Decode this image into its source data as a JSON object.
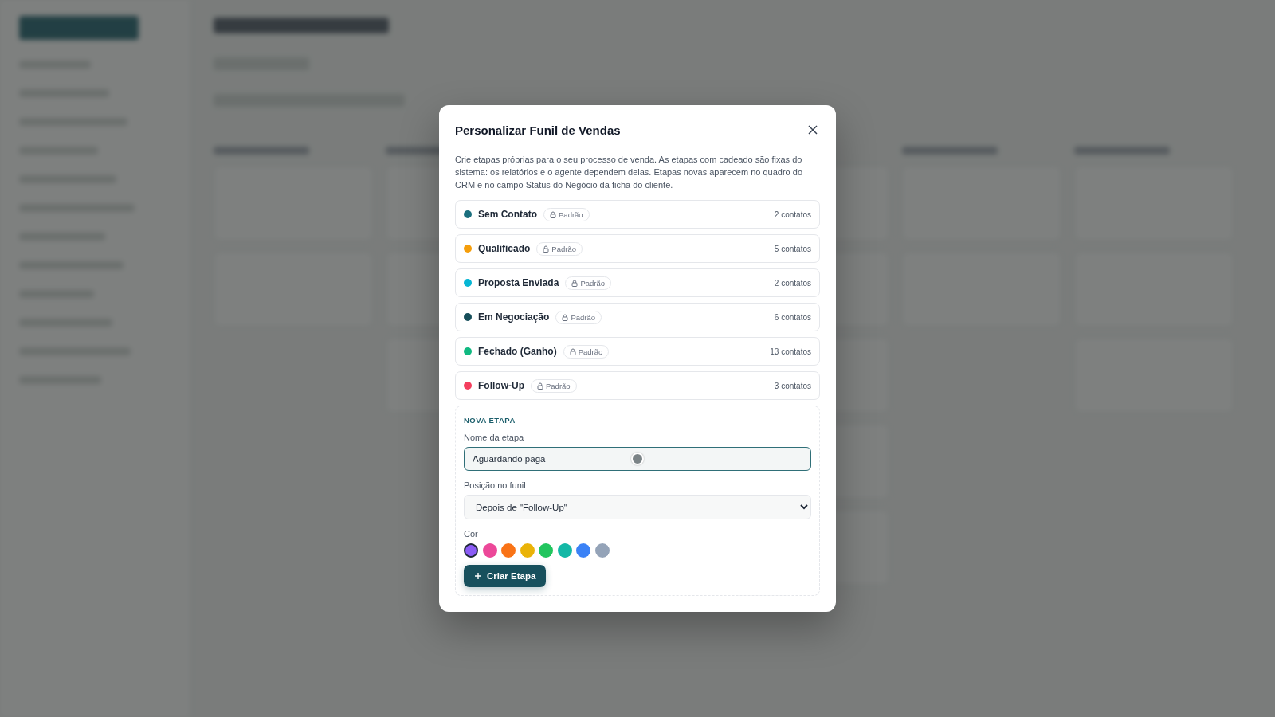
{
  "dialog": {
    "title": "Personalizar Funil de Vendas",
    "description": "Crie etapas próprias para o seu processo de venda. As etapas com cadeado são fixas do sistema: os relatórios e o agente dependem delas. Etapas novas aparecem no quadro do CRM e no campo Status do Negócio da ficha do cliente.",
    "stages": [
      {
        "name": "Sem Contato",
        "badge": "Padrão",
        "count": "2 contatos",
        "color": "#1b6f7e"
      },
      {
        "name": "Qualificado",
        "badge": "Padrão",
        "count": "5 contatos",
        "color": "#f59e0b"
      },
      {
        "name": "Proposta Enviada",
        "badge": "Padrão",
        "count": "2 contatos",
        "color": "#06b6d4"
      },
      {
        "name": "Em Negociação",
        "badge": "Padrão",
        "count": "6 contatos",
        "color": "#164e5a"
      },
      {
        "name": "Fechado (Ganho)",
        "badge": "Padrão",
        "count": "13 contatos",
        "color": "#10b981"
      },
      {
        "name": "Follow-Up",
        "badge": "Padrão",
        "count": "3 contatos",
        "color": "#f43f5e"
      }
    ],
    "new_stage": {
      "heading": "NOVA ETAPA",
      "name_label": "Nome da etapa",
      "name_value": "Aguardando paga",
      "position_label": "Posição no funil",
      "position_value": "Depois de \"Follow-Up\"",
      "color_label": "Cor",
      "colors": [
        {
          "color": "#8b5cf6",
          "selected": true
        },
        {
          "color": "#ec4899",
          "selected": false
        },
        {
          "color": "#f97316",
          "selected": false
        },
        {
          "color": "#eab308",
          "selected": false
        },
        {
          "color": "#22c55e",
          "selected": false
        },
        {
          "color": "#14b8a6",
          "selected": false
        },
        {
          "color": "#3b82f6",
          "selected": false
        },
        {
          "color": "#94a3b8",
          "selected": false
        }
      ],
      "submit": "Criar Etapa"
    }
  }
}
